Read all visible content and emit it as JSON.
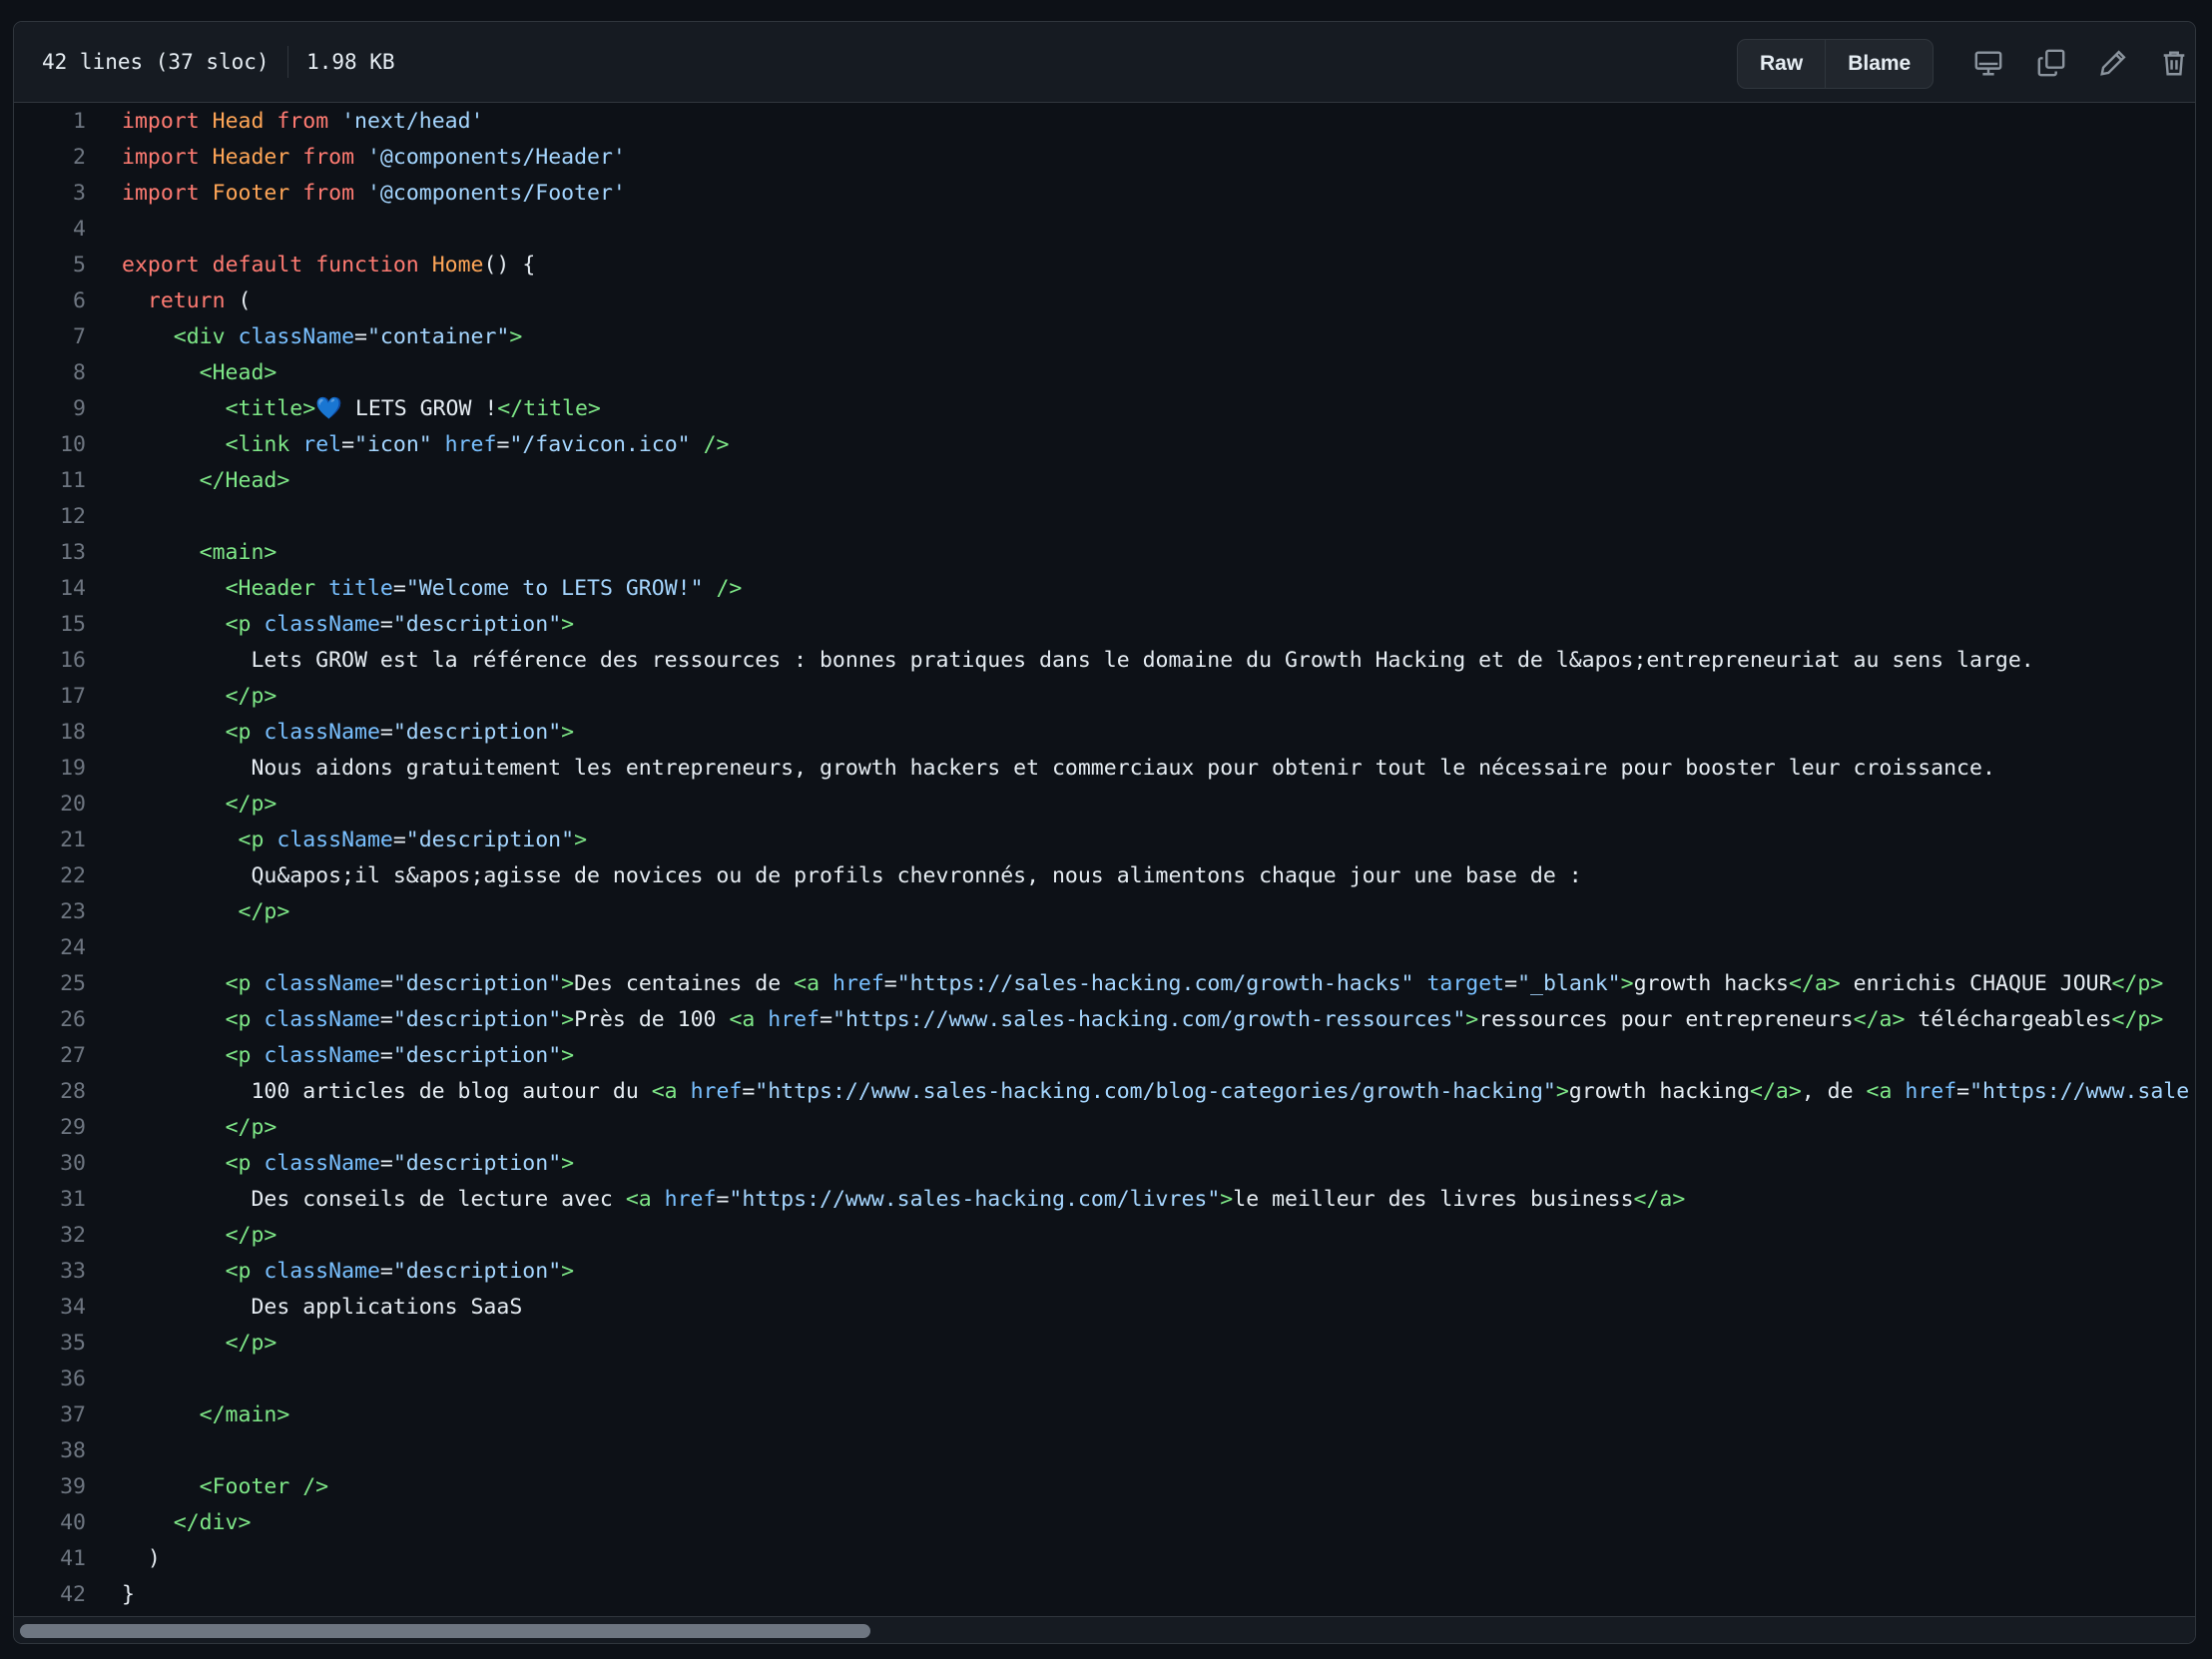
{
  "file_header": {
    "lines_info": "42 lines (37 sloc)",
    "size": "1.98 KB",
    "raw_label": "Raw",
    "blame_label": "Blame",
    "icons": [
      "desktop-icon",
      "copy-icon",
      "pencil-icon",
      "trash-icon"
    ]
  },
  "colors": {
    "background": "#0d1117",
    "header_bg": "#161b22",
    "border": "#30363d",
    "keyword": "#ff7b72",
    "identifier": "#ffa657",
    "string": "#a5d6ff",
    "tag": "#7ee787",
    "attribute": "#79c0ff",
    "line_number": "#6e7681"
  },
  "code": {
    "lines": [
      [
        [
          "kw",
          "import"
        ],
        [
          "t",
          " "
        ],
        [
          "id",
          "Head"
        ],
        [
          "t",
          " "
        ],
        [
          "kw",
          "from"
        ],
        [
          "t",
          " "
        ],
        [
          "str",
          "'next/head'"
        ]
      ],
      [
        [
          "kw",
          "import"
        ],
        [
          "t",
          " "
        ],
        [
          "id",
          "Header"
        ],
        [
          "t",
          " "
        ],
        [
          "kw",
          "from"
        ],
        [
          "t",
          " "
        ],
        [
          "str",
          "'@components/Header'"
        ]
      ],
      [
        [
          "kw",
          "import"
        ],
        [
          "t",
          " "
        ],
        [
          "id",
          "Footer"
        ],
        [
          "t",
          " "
        ],
        [
          "kw",
          "from"
        ],
        [
          "t",
          " "
        ],
        [
          "str",
          "'@components/Footer'"
        ]
      ],
      [],
      [
        [
          "kw",
          "export"
        ],
        [
          "t",
          " "
        ],
        [
          "kw",
          "default"
        ],
        [
          "t",
          " "
        ],
        [
          "kw",
          "function"
        ],
        [
          "t",
          " "
        ],
        [
          "id",
          "Home"
        ],
        [
          "t",
          "() {"
        ]
      ],
      [
        [
          "t",
          "  "
        ],
        [
          "kw",
          "return"
        ],
        [
          "t",
          " ("
        ]
      ],
      [
        [
          "t",
          "    "
        ],
        [
          "tag",
          "<div"
        ],
        [
          "t",
          " "
        ],
        [
          "attr",
          "className"
        ],
        [
          "t",
          "="
        ],
        [
          "str",
          "\"container\""
        ],
        [
          "tag",
          ">"
        ]
      ],
      [
        [
          "t",
          "      "
        ],
        [
          "tag",
          "<Head>"
        ]
      ],
      [
        [
          "t",
          "        "
        ],
        [
          "tag",
          "<title>"
        ],
        [
          "t",
          "💙 LETS GROW !"
        ],
        [
          "tag",
          "</title>"
        ]
      ],
      [
        [
          "t",
          "        "
        ],
        [
          "tag",
          "<link"
        ],
        [
          "t",
          " "
        ],
        [
          "attr",
          "rel"
        ],
        [
          "t",
          "="
        ],
        [
          "str",
          "\"icon\""
        ],
        [
          "t",
          " "
        ],
        [
          "attr",
          "href"
        ],
        [
          "t",
          "="
        ],
        [
          "str",
          "\"/favicon.ico\""
        ],
        [
          "t",
          " "
        ],
        [
          "tag",
          "/>"
        ]
      ],
      [
        [
          "t",
          "      "
        ],
        [
          "tag",
          "</Head>"
        ]
      ],
      [],
      [
        [
          "t",
          "      "
        ],
        [
          "tag",
          "<main>"
        ]
      ],
      [
        [
          "t",
          "        "
        ],
        [
          "tag",
          "<Header"
        ],
        [
          "t",
          " "
        ],
        [
          "attr",
          "title"
        ],
        [
          "t",
          "="
        ],
        [
          "str",
          "\"Welcome to LETS GROW!\""
        ],
        [
          "t",
          " "
        ],
        [
          "tag",
          "/>"
        ]
      ],
      [
        [
          "t",
          "        "
        ],
        [
          "tag",
          "<p"
        ],
        [
          "t",
          " "
        ],
        [
          "attr",
          "className"
        ],
        [
          "t",
          "="
        ],
        [
          "str",
          "\"description\""
        ],
        [
          "tag",
          ">"
        ]
      ],
      [
        [
          "t",
          "          Lets GROW est la référence des ressources : bonnes pratiques dans le domaine du Growth Hacking et de l&apos;entrepreneuriat au sens large."
        ]
      ],
      [
        [
          "t",
          "        "
        ],
        [
          "tag",
          "</p>"
        ]
      ],
      [
        [
          "t",
          "        "
        ],
        [
          "tag",
          "<p"
        ],
        [
          "t",
          " "
        ],
        [
          "attr",
          "className"
        ],
        [
          "t",
          "="
        ],
        [
          "str",
          "\"description\""
        ],
        [
          "tag",
          ">"
        ]
      ],
      [
        [
          "t",
          "          Nous aidons gratuitement les entrepreneurs, growth hackers et commerciaux pour obtenir tout le nécessaire pour booster leur croissance."
        ]
      ],
      [
        [
          "t",
          "        "
        ],
        [
          "tag",
          "</p>"
        ]
      ],
      [
        [
          "t",
          "         "
        ],
        [
          "tag",
          "<p"
        ],
        [
          "t",
          " "
        ],
        [
          "attr",
          "className"
        ],
        [
          "t",
          "="
        ],
        [
          "str",
          "\"description\""
        ],
        [
          "tag",
          ">"
        ]
      ],
      [
        [
          "t",
          "          Qu&apos;il s&apos;agisse de novices ou de profils chevronnés, nous alimentons chaque jour une base de :"
        ]
      ],
      [
        [
          "t",
          "         "
        ],
        [
          "tag",
          "</p>"
        ]
      ],
      [],
      [
        [
          "t",
          "        "
        ],
        [
          "tag",
          "<p"
        ],
        [
          "t",
          " "
        ],
        [
          "attr",
          "className"
        ],
        [
          "t",
          "="
        ],
        [
          "str",
          "\"description\""
        ],
        [
          "tag",
          ">"
        ],
        [
          "t",
          "Des centaines de "
        ],
        [
          "tag",
          "<a"
        ],
        [
          "t",
          " "
        ],
        [
          "attr",
          "href"
        ],
        [
          "t",
          "="
        ],
        [
          "str",
          "\"https://sales-hacking.com/growth-hacks\""
        ],
        [
          "t",
          " "
        ],
        [
          "attr",
          "target"
        ],
        [
          "t",
          "="
        ],
        [
          "str",
          "\"_blank\""
        ],
        [
          "tag",
          ">"
        ],
        [
          "t",
          "growth hacks"
        ],
        [
          "tag",
          "</a>"
        ],
        [
          "t",
          " enrichis CHAQUE JOUR"
        ],
        [
          "tag",
          "</p>"
        ]
      ],
      [
        [
          "t",
          "        "
        ],
        [
          "tag",
          "<p"
        ],
        [
          "t",
          " "
        ],
        [
          "attr",
          "className"
        ],
        [
          "t",
          "="
        ],
        [
          "str",
          "\"description\""
        ],
        [
          "tag",
          ">"
        ],
        [
          "t",
          "Près de 100 "
        ],
        [
          "tag",
          "<a"
        ],
        [
          "t",
          " "
        ],
        [
          "attr",
          "href"
        ],
        [
          "t",
          "="
        ],
        [
          "str",
          "\"https://www.sales-hacking.com/growth-ressources\""
        ],
        [
          "tag",
          ">"
        ],
        [
          "t",
          "ressources pour entrepreneurs"
        ],
        [
          "tag",
          "</a>"
        ],
        [
          "t",
          " téléchargeables"
        ],
        [
          "tag",
          "</p>"
        ]
      ],
      [
        [
          "t",
          "        "
        ],
        [
          "tag",
          "<p"
        ],
        [
          "t",
          " "
        ],
        [
          "attr",
          "className"
        ],
        [
          "t",
          "="
        ],
        [
          "str",
          "\"description\""
        ],
        [
          "tag",
          ">"
        ]
      ],
      [
        [
          "t",
          "          100 articles de blog autour du "
        ],
        [
          "tag",
          "<a"
        ],
        [
          "t",
          " "
        ],
        [
          "attr",
          "href"
        ],
        [
          "t",
          "="
        ],
        [
          "str",
          "\"https://www.sales-hacking.com/blog-categories/growth-hacking\""
        ],
        [
          "tag",
          ">"
        ],
        [
          "t",
          "growth hacking"
        ],
        [
          "tag",
          "</a>"
        ],
        [
          "t",
          ", de "
        ],
        [
          "tag",
          "<a"
        ],
        [
          "t",
          " "
        ],
        [
          "attr",
          "href"
        ],
        [
          "t",
          "="
        ],
        [
          "str",
          "\"https://www.sale"
        ]
      ],
      [
        [
          "t",
          "        "
        ],
        [
          "tag",
          "</p>"
        ]
      ],
      [
        [
          "t",
          "        "
        ],
        [
          "tag",
          "<p"
        ],
        [
          "t",
          " "
        ],
        [
          "attr",
          "className"
        ],
        [
          "t",
          "="
        ],
        [
          "str",
          "\"description\""
        ],
        [
          "tag",
          ">"
        ]
      ],
      [
        [
          "t",
          "          Des conseils de lecture avec "
        ],
        [
          "tag",
          "<a"
        ],
        [
          "t",
          " "
        ],
        [
          "attr",
          "href"
        ],
        [
          "t",
          "="
        ],
        [
          "str",
          "\"https://www.sales-hacking.com/livres\""
        ],
        [
          "tag",
          ">"
        ],
        [
          "t",
          "le meilleur des livres business"
        ],
        [
          "tag",
          "</a>"
        ]
      ],
      [
        [
          "t",
          "        "
        ],
        [
          "tag",
          "</p>"
        ]
      ],
      [
        [
          "t",
          "        "
        ],
        [
          "tag",
          "<p"
        ],
        [
          "t",
          " "
        ],
        [
          "attr",
          "className"
        ],
        [
          "t",
          "="
        ],
        [
          "str",
          "\"description\""
        ],
        [
          "tag",
          ">"
        ]
      ],
      [
        [
          "t",
          "          Des applications SaaS"
        ]
      ],
      [
        [
          "t",
          "        "
        ],
        [
          "tag",
          "</p>"
        ]
      ],
      [],
      [
        [
          "t",
          "      "
        ],
        [
          "tag",
          "</main>"
        ]
      ],
      [],
      [
        [
          "t",
          "      "
        ],
        [
          "tag",
          "<Footer"
        ],
        [
          "t",
          " "
        ],
        [
          "tag",
          "/>"
        ]
      ],
      [
        [
          "t",
          "    "
        ],
        [
          "tag",
          "</div>"
        ]
      ],
      [
        [
          "t",
          "  )"
        ]
      ],
      [
        [
          "t",
          "}"
        ]
      ]
    ]
  },
  "scrollbar": {
    "horizontal_position": 0,
    "visible_fraction": 0.39
  }
}
